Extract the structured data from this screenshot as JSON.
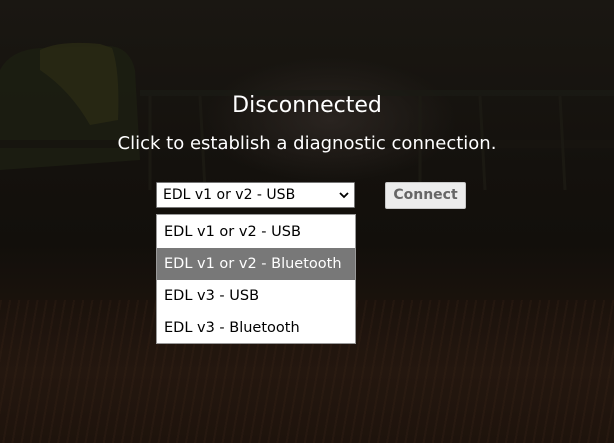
{
  "status": {
    "title": "Disconnected",
    "subtitle": "Click to establish a diagnostic connection."
  },
  "connection": {
    "selected": "EDL v1 or v2 - USB",
    "options": [
      {
        "label": "EDL v1 or v2 - USB",
        "highlighted": false
      },
      {
        "label": "EDL v1 or v2 - Bluetooth",
        "highlighted": true
      },
      {
        "label": "EDL v3 - USB",
        "highlighted": false
      },
      {
        "label": "EDL v3 - Bluetooth",
        "highlighted": false
      }
    ],
    "connect_label": "Connect"
  },
  "icons": {
    "select_chevron": "chevron-down-icon"
  },
  "colors": {
    "text": "#ffffff",
    "highlight": "#787878",
    "button_text": "#666666"
  }
}
